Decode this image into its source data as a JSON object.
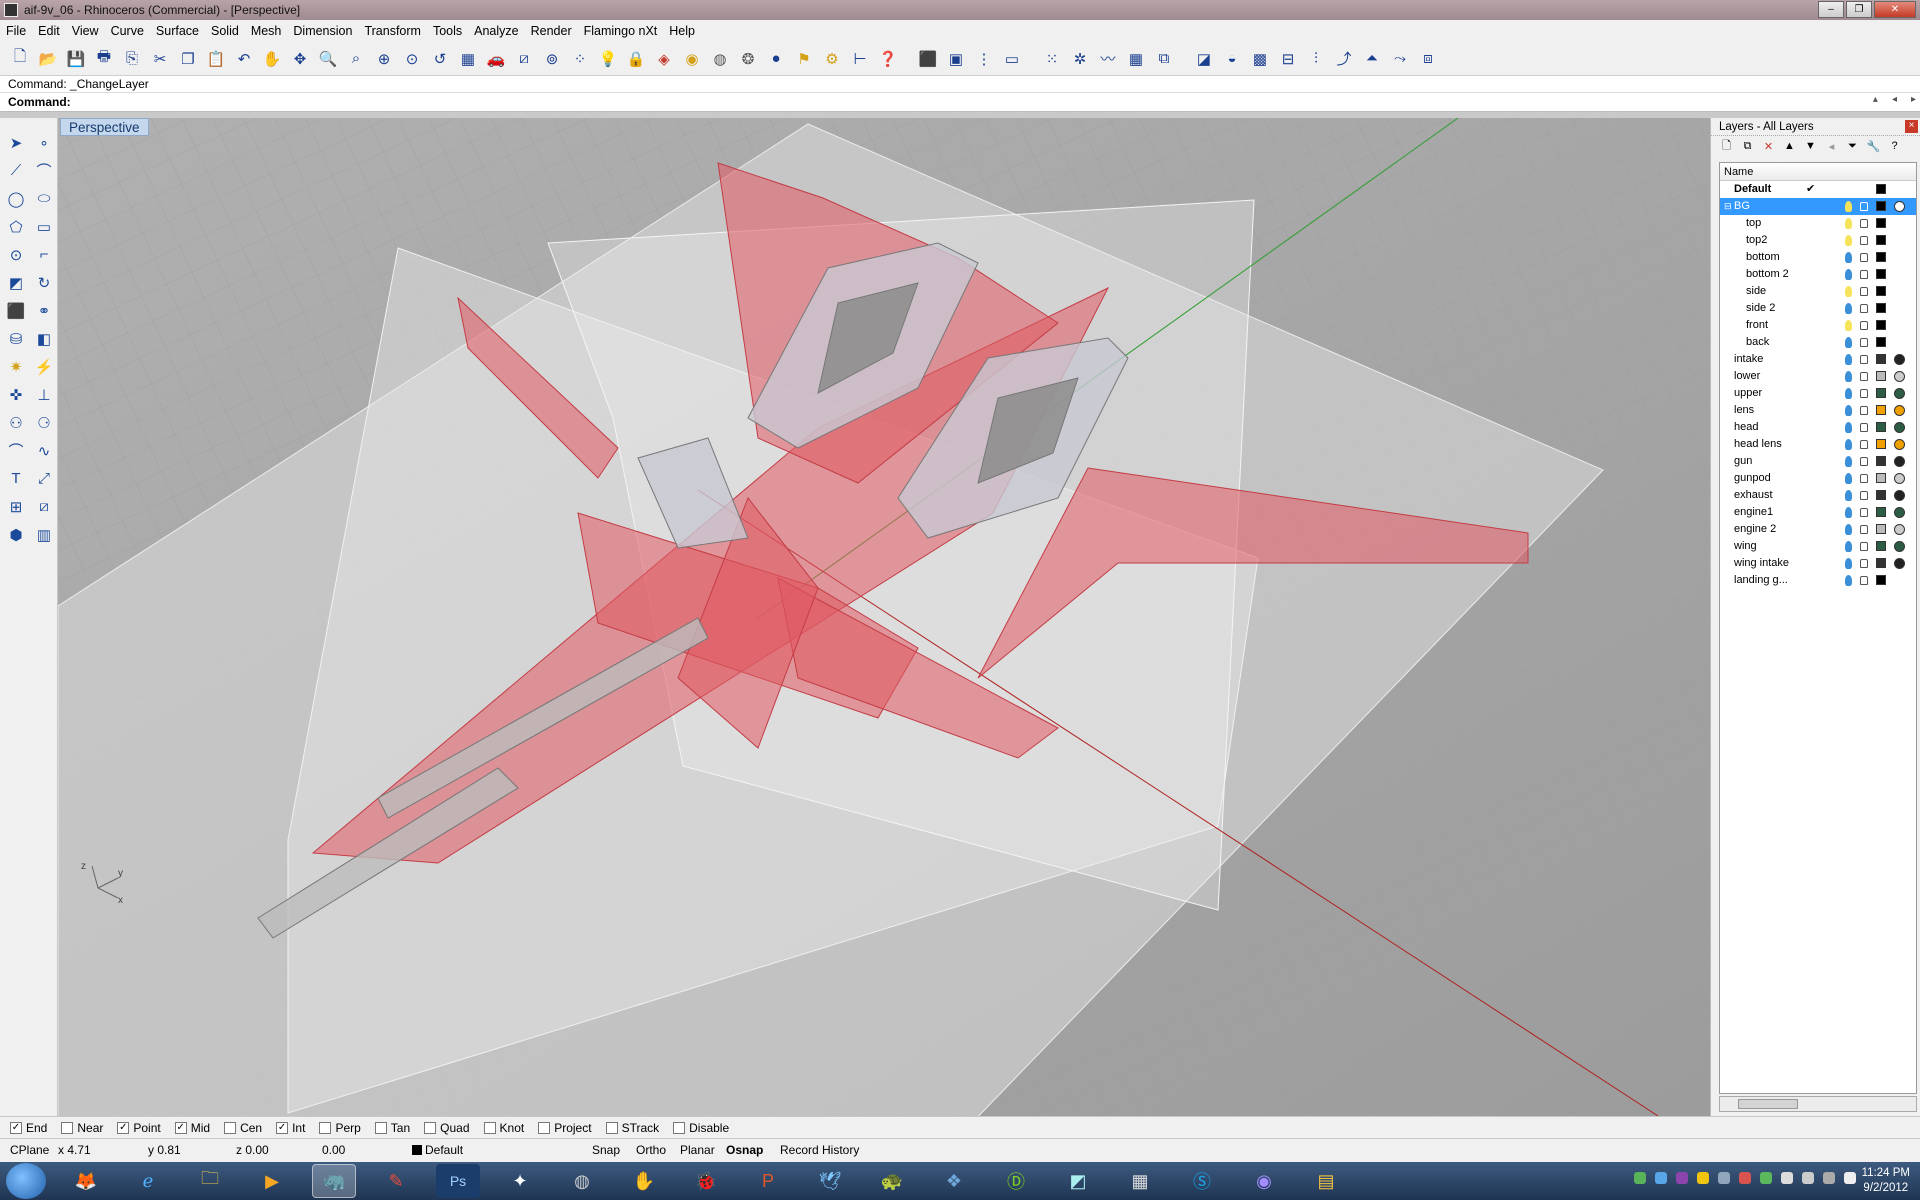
{
  "window": {
    "title": "aif-9v_06 - Rhinoceros (Commercial) - [Perspective]",
    "buttons": [
      "–",
      "❐",
      "✕"
    ]
  },
  "menu": [
    "File",
    "Edit",
    "View",
    "Curve",
    "Surface",
    "Solid",
    "Mesh",
    "Dimension",
    "Transform",
    "Tools",
    "Analyze",
    "Render",
    "Flamingo nXt",
    "Help"
  ],
  "command": {
    "history": "Command: _ChangeLayer",
    "prompt": "Command:"
  },
  "viewport": {
    "label": "Perspective",
    "axes": {
      "z": "z",
      "y": "y",
      "x": "x"
    }
  },
  "layers_panel": {
    "title": "Layers - All Layers",
    "column_name": "Name",
    "layers": [
      {
        "name": "Default",
        "indent": 1,
        "current": true,
        "bold": true,
        "color": "#000000"
      },
      {
        "name": "BG",
        "indent": 0,
        "expanded": true,
        "selected": true,
        "bulb": "#f5e35a",
        "color": "#000000",
        "material": "#ffffff"
      },
      {
        "name": "top",
        "indent": 2,
        "bulb": "#f5e35a",
        "color": "#000000"
      },
      {
        "name": "top2",
        "indent": 2,
        "bulb": "#f5e35a",
        "color": "#000000"
      },
      {
        "name": "bottom",
        "indent": 2,
        "bulb": "#3a8fd8",
        "color": "#000000"
      },
      {
        "name": "bottom 2",
        "indent": 2,
        "bulb": "#3a8fd8",
        "color": "#000000"
      },
      {
        "name": "side",
        "indent": 2,
        "bulb": "#f5e35a",
        "color": "#000000"
      },
      {
        "name": "side 2",
        "indent": 2,
        "bulb": "#3a8fd8",
        "color": "#000000"
      },
      {
        "name": "front",
        "indent": 2,
        "bulb": "#f5e35a",
        "color": "#000000"
      },
      {
        "name": "back",
        "indent": 2,
        "bulb": "#3a8fd8",
        "color": "#000000"
      },
      {
        "name": "intake",
        "indent": 1,
        "bulb": "#3a8fd8",
        "color": "#333333",
        "material": "#222222"
      },
      {
        "name": "lower",
        "indent": 1,
        "bulb": "#3a8fd8",
        "color": "#bbbbbb",
        "material": "#cccccc"
      },
      {
        "name": "upper",
        "indent": 1,
        "bulb": "#3a8fd8",
        "color": "#2c5c44",
        "material": "#2c5c44"
      },
      {
        "name": "lens",
        "indent": 1,
        "bulb": "#3a8fd8",
        "color": "#f0a000",
        "material": "#f0a000"
      },
      {
        "name": "head",
        "indent": 1,
        "bulb": "#3a8fd8",
        "color": "#2c5c44",
        "material": "#2c5c44"
      },
      {
        "name": "head lens",
        "indent": 1,
        "bulb": "#3a8fd8",
        "color": "#f0a000",
        "material": "#f0a000"
      },
      {
        "name": "gun",
        "indent": 1,
        "bulb": "#3a8fd8",
        "color": "#333333",
        "material": "#222222"
      },
      {
        "name": "gunpod",
        "indent": 1,
        "bulb": "#3a8fd8",
        "color": "#bbbbbb",
        "material": "#cccccc"
      },
      {
        "name": "exhaust",
        "indent": 1,
        "bulb": "#3a8fd8",
        "color": "#333333",
        "material": "#222222"
      },
      {
        "name": "engine1",
        "indent": 1,
        "bulb": "#3a8fd8",
        "color": "#2c5c44",
        "material": "#2c5c44"
      },
      {
        "name": "engine 2",
        "indent": 1,
        "bulb": "#3a8fd8",
        "color": "#bbbbbb",
        "material": "#cccccc"
      },
      {
        "name": "wing",
        "indent": 1,
        "bulb": "#3a8fd8",
        "color": "#2c5c44",
        "material": "#2c5c44"
      },
      {
        "name": "wing intake",
        "indent": 1,
        "bulb": "#3a8fd8",
        "color": "#333333",
        "material": "#222222"
      },
      {
        "name": "landing g...",
        "indent": 1,
        "bulb": "#3a8fd8",
        "color": "#000000"
      }
    ]
  },
  "osnap": [
    {
      "label": "End",
      "checked": true
    },
    {
      "label": "Near",
      "checked": false
    },
    {
      "label": "Point",
      "checked": true
    },
    {
      "label": "Mid",
      "checked": true
    },
    {
      "label": "Cen",
      "checked": false
    },
    {
      "label": "Int",
      "checked": true
    },
    {
      "label": "Perp",
      "checked": false
    },
    {
      "label": "Tan",
      "checked": false
    },
    {
      "label": "Quad",
      "checked": false
    },
    {
      "label": "Knot",
      "checked": false
    },
    {
      "label": "Project",
      "checked": false
    },
    {
      "label": "STrack",
      "checked": false
    },
    {
      "label": "Disable",
      "checked": false
    }
  ],
  "status": {
    "cplane": "CPlane",
    "x": "x 4.71",
    "y": "y 0.81",
    "z": "z 0.00",
    "dist": "0.00",
    "layer": "Default",
    "snap": "Snap",
    "ortho": "Ortho",
    "planar": "Planar",
    "osnap": "Osnap",
    "record_history": "Record History"
  },
  "taskbar": {
    "clock_time": "11:24 PM",
    "clock_date": "9/2/2012"
  },
  "colors": {
    "selection": "#3399ff",
    "viewport_bg": "#a3a3a3",
    "model_red": "#e05a62"
  }
}
